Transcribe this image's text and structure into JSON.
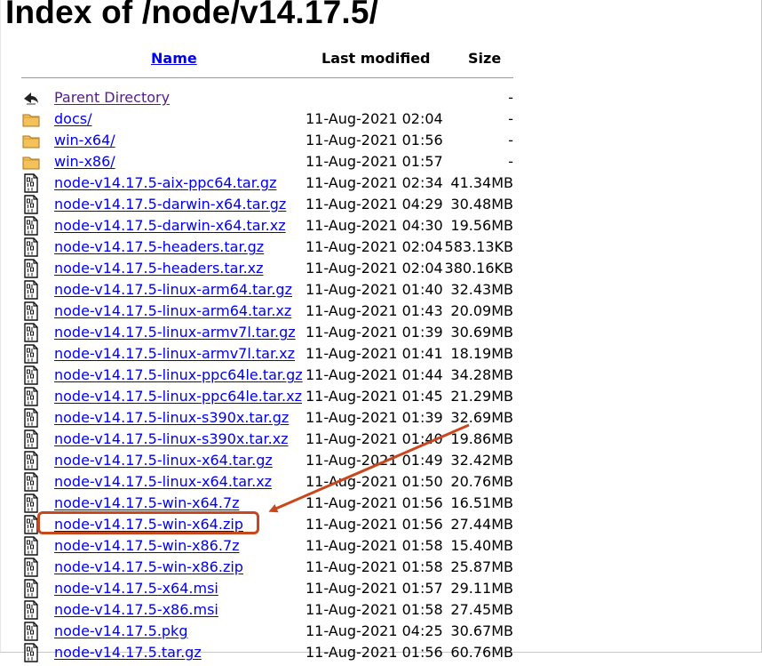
{
  "page": {
    "title": "Index of /node/v14.17.5/",
    "columns": {
      "name": "Name",
      "modified": "Last modified",
      "size": "Size"
    },
    "annotation_color": "#c8471d",
    "link_color": "#0000ee",
    "visited_color": "#551a8b"
  },
  "rows": [
    {
      "name": "Parent Directory",
      "modified": "",
      "size": "-",
      "icon": "back-arrow-icon",
      "visited": true
    },
    {
      "name": "docs/",
      "modified": "11-Aug-2021 02:04",
      "size": "-",
      "icon": "folder-icon"
    },
    {
      "name": "win-x64/",
      "modified": "11-Aug-2021 01:56",
      "size": "-",
      "icon": "folder-icon"
    },
    {
      "name": "win-x86/",
      "modified": "11-Aug-2021 01:57",
      "size": "-",
      "icon": "folder-icon"
    },
    {
      "name": "node-v14.17.5-aix-ppc64.tar.gz",
      "modified": "11-Aug-2021 02:34",
      "size": "41.34MB",
      "icon": "binary-file-icon"
    },
    {
      "name": "node-v14.17.5-darwin-x64.tar.gz",
      "modified": "11-Aug-2021 04:29",
      "size": "30.48MB",
      "icon": "binary-file-icon"
    },
    {
      "name": "node-v14.17.5-darwin-x64.tar.xz",
      "modified": "11-Aug-2021 04:30",
      "size": "19.56MB",
      "icon": "binary-file-icon"
    },
    {
      "name": "node-v14.17.5-headers.tar.gz",
      "modified": "11-Aug-2021 02:04",
      "size": "583.13KB",
      "icon": "binary-file-icon"
    },
    {
      "name": "node-v14.17.5-headers.tar.xz",
      "modified": "11-Aug-2021 02:04",
      "size": "380.16KB",
      "icon": "binary-file-icon"
    },
    {
      "name": "node-v14.17.5-linux-arm64.tar.gz",
      "modified": "11-Aug-2021 01:40",
      "size": "32.43MB",
      "icon": "binary-file-icon"
    },
    {
      "name": "node-v14.17.5-linux-arm64.tar.xz",
      "modified": "11-Aug-2021 01:43",
      "size": "20.09MB",
      "icon": "binary-file-icon"
    },
    {
      "name": "node-v14.17.5-linux-armv7l.tar.gz",
      "modified": "11-Aug-2021 01:39",
      "size": "30.69MB",
      "icon": "binary-file-icon"
    },
    {
      "name": "node-v14.17.5-linux-armv7l.tar.xz",
      "modified": "11-Aug-2021 01:41",
      "size": "18.19MB",
      "icon": "binary-file-icon"
    },
    {
      "name": "node-v14.17.5-linux-ppc64le.tar.gz",
      "modified": "11-Aug-2021 01:44",
      "size": "34.28MB",
      "icon": "binary-file-icon"
    },
    {
      "name": "node-v14.17.5-linux-ppc64le.tar.xz",
      "modified": "11-Aug-2021 01:45",
      "size": "21.29MB",
      "icon": "binary-file-icon"
    },
    {
      "name": "node-v14.17.5-linux-s390x.tar.gz",
      "modified": "11-Aug-2021 01:39",
      "size": "32.69MB",
      "icon": "binary-file-icon"
    },
    {
      "name": "node-v14.17.5-linux-s390x.tar.xz",
      "modified": "11-Aug-2021 01:40",
      "size": "19.86MB",
      "icon": "binary-file-icon"
    },
    {
      "name": "node-v14.17.5-linux-x64.tar.gz",
      "modified": "11-Aug-2021 01:49",
      "size": "32.42MB",
      "icon": "binary-file-icon"
    },
    {
      "name": "node-v14.17.5-linux-x64.tar.xz",
      "modified": "11-Aug-2021 01:50",
      "size": "20.76MB",
      "icon": "binary-file-icon"
    },
    {
      "name": "node-v14.17.5-win-x64.7z",
      "modified": "11-Aug-2021 01:56",
      "size": "16.51MB",
      "icon": "binary-file-icon"
    },
    {
      "name": "node-v14.17.5-win-x64.zip",
      "modified": "11-Aug-2021 01:56",
      "size": "27.44MB",
      "icon": "binary-file-icon",
      "highlighted": true
    },
    {
      "name": "node-v14.17.5-win-x86.7z",
      "modified": "11-Aug-2021 01:58",
      "size": "15.40MB",
      "icon": "binary-file-icon"
    },
    {
      "name": "node-v14.17.5-win-x86.zip",
      "modified": "11-Aug-2021 01:58",
      "size": "25.87MB",
      "icon": "binary-file-icon"
    },
    {
      "name": "node-v14.17.5-x64.msi",
      "modified": "11-Aug-2021 01:57",
      "size": "29.11MB",
      "icon": "binary-file-icon"
    },
    {
      "name": "node-v14.17.5-x86.msi",
      "modified": "11-Aug-2021 01:58",
      "size": "27.45MB",
      "icon": "binary-file-icon"
    },
    {
      "name": "node-v14.17.5.pkg",
      "modified": "11-Aug-2021 04:25",
      "size": "30.67MB",
      "icon": "binary-file-icon"
    },
    {
      "name": "node-v14.17.5.tar.gz",
      "modified": "11-Aug-2021 01:56",
      "size": "60.76MB",
      "icon": "binary-file-icon"
    }
  ]
}
